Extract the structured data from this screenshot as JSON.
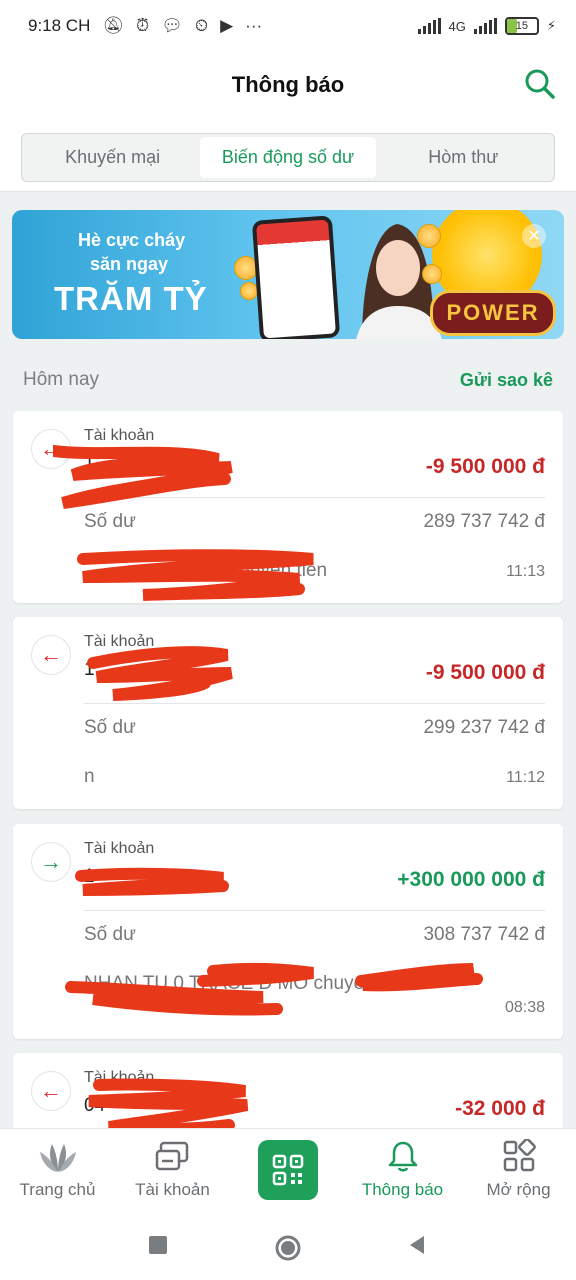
{
  "status_bar": {
    "time": "9:18 CH",
    "battery": "15",
    "network": "4G"
  },
  "header": {
    "title": "Thông báo"
  },
  "tabs": [
    {
      "label": "Khuyến mại",
      "active": false
    },
    {
      "label": "Biến động số dư",
      "active": true
    },
    {
      "label": "Hòm thư",
      "active": false
    }
  ],
  "banner": {
    "line1": "Hè cực cháy",
    "line2": "săn ngay",
    "line3": "TRĂM TỶ",
    "badge": "POWER"
  },
  "section": {
    "title": "Hôm nay",
    "action": "Gửi sao kê"
  },
  "transactions": [
    {
      "direction": "out",
      "label": "Tài khoản",
      "account": "1",
      "amount": "-9 500 000 đ",
      "balance_label": "Số dư",
      "balance": "289 737 742 đ",
      "description": "A chuyen tien",
      "time": "11:13"
    },
    {
      "direction": "out",
      "label": "Tài khoản",
      "account": "1",
      "amount": "-9 500 000 đ",
      "balance_label": "Số dư",
      "balance": "299 237 742 đ",
      "description": "n",
      "time": "11:12"
    },
    {
      "direction": "in",
      "label": "Tài khoản",
      "account": "1",
      "amount": "+300 000 000 đ",
      "balance_label": "Số dư",
      "balance": "308 737 742 đ",
      "description": "NHAN TU 0 TRACE D MO chuyen tien",
      "time": "08:38"
    },
    {
      "direction": "out",
      "label": "Tài khoản",
      "account": "04",
      "amount": "-32 000 đ"
    }
  ],
  "bottom_nav": [
    {
      "label": "Trang chủ",
      "icon": "home-leaf-icon"
    },
    {
      "label": "Tài khoản",
      "icon": "account-card-icon"
    },
    {
      "label": "",
      "icon": "qr-scan-icon"
    },
    {
      "label": "Thông báo",
      "icon": "bell-icon",
      "active": true
    },
    {
      "label": "Mở rộng",
      "icon": "grid-icon"
    }
  ],
  "colors": {
    "brand_green": "#1a9a5a",
    "debit_red": "#c62828"
  }
}
